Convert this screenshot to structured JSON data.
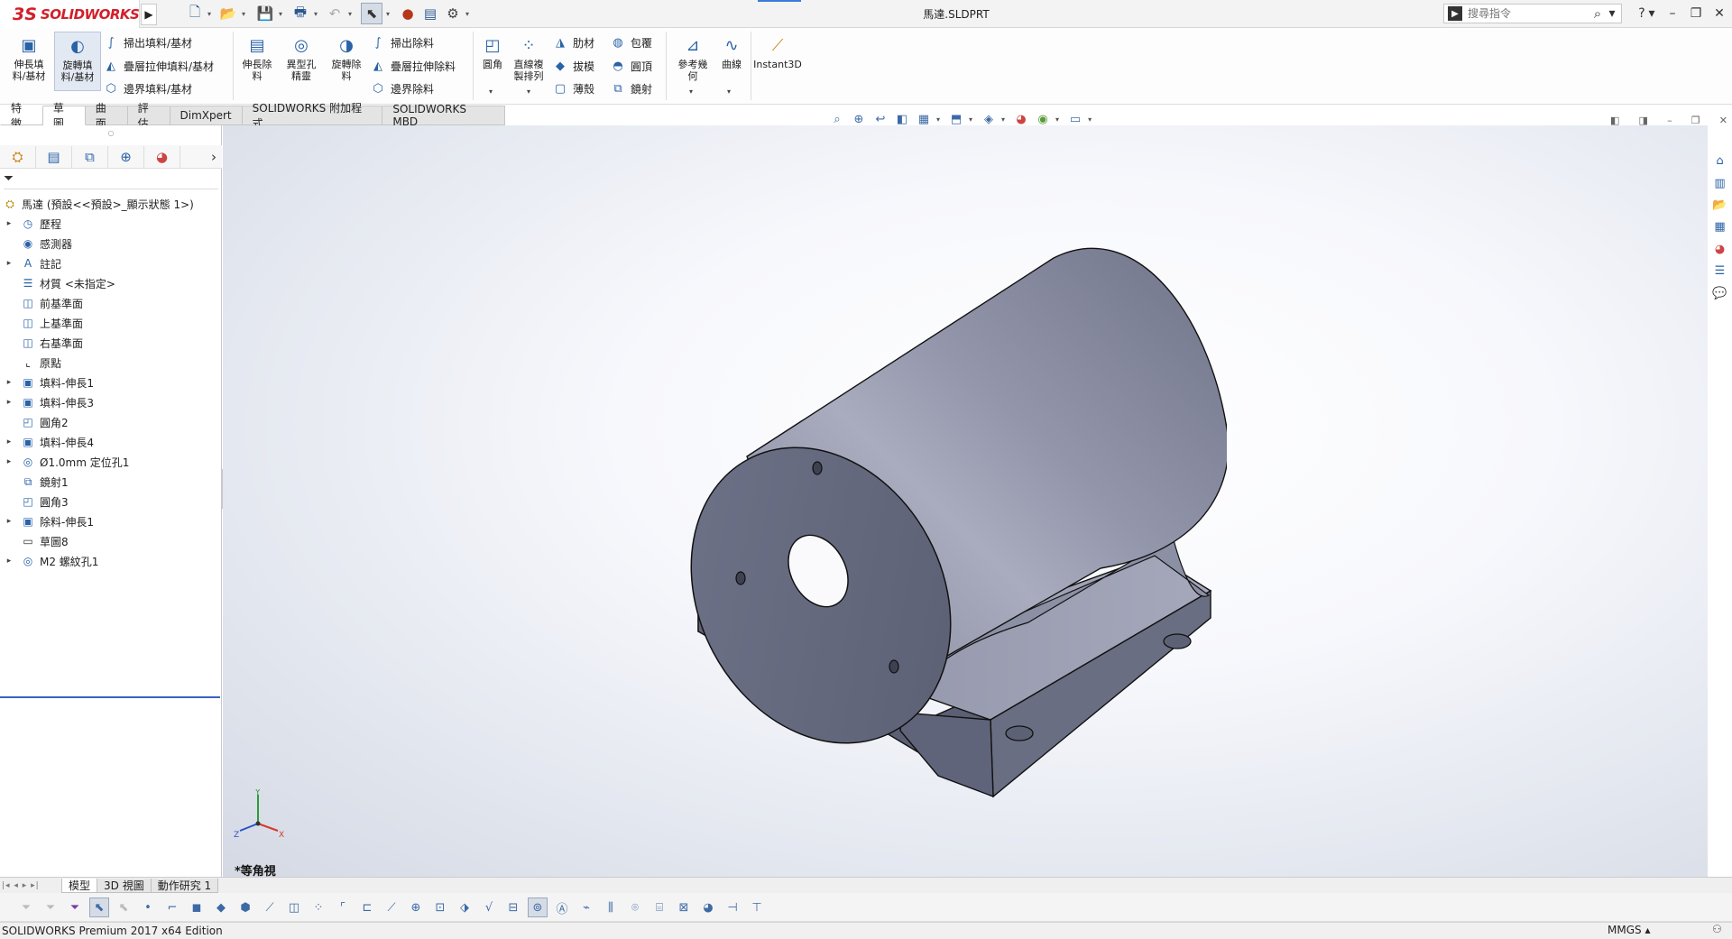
{
  "app": {
    "logo_ds": "3S",
    "logo_text": "SOLIDWORKS",
    "doc_title": "馬達.SLDPRT",
    "search_placeholder": "搜尋指令"
  },
  "colors": {
    "brand": "#d21f2b",
    "accent": "#3a7ad8",
    "model_face": "#8d91a7",
    "model_dark": "#5d6075",
    "selection": "#3a63c2"
  },
  "quick_access": [
    {
      "name": "new-document-icon",
      "glyph": "🗋"
    },
    {
      "name": "open-icon",
      "glyph": "📂"
    },
    {
      "name": "save-icon",
      "glyph": "💾"
    },
    {
      "name": "print-icon",
      "glyph": "🖶"
    },
    {
      "name": "undo-icon",
      "glyph": "↶"
    },
    {
      "name": "select-icon",
      "glyph": "⬉"
    },
    {
      "name": "rebuild-icon",
      "glyph": "🚦"
    },
    {
      "name": "file-properties-icon",
      "glyph": "▤"
    },
    {
      "name": "options-icon",
      "glyph": "⚙"
    }
  ],
  "ribbon": {
    "extrude_boss": "伸長填\n料/基材",
    "revolve_boss": "旋轉填\n料/基材",
    "sweep_boss": "掃出填料/基材",
    "loft_boss": "疊層拉伸填料/基材",
    "boundary_boss": "邊界填料/基材",
    "extrude_cut": "伸長除\n料",
    "hole_wizard": "異型孔\n精靈",
    "revolve_cut": "旋轉除\n料",
    "sweep_cut": "掃出除料",
    "loft_cut": "疊層拉伸除料",
    "boundary_cut": "邊界除料",
    "fillet": "圓角",
    "linear_pattern": "直線複\n製排列",
    "rib": "肋材",
    "draft": "拔模",
    "shell": "薄殼",
    "wrap": "包覆",
    "dome": "圓頂",
    "mirror": "鏡射",
    "reference_geometry": "參考幾\n何",
    "curves": "曲線",
    "instant3d": "Instant3D"
  },
  "command_tabs": [
    "特徵",
    "草圖",
    "曲面",
    "評估",
    "DimXpert",
    "SOLIDWORKS 附加程式",
    "SOLIDWORKS MBD"
  ],
  "feature_tree": [
    {
      "label": "馬達 (預設<<預設>_顯示狀態 1>)",
      "expand": "",
      "glyph": "⛭",
      "root": true
    },
    {
      "label": "歷程",
      "expand": "▸",
      "glyph": "◷"
    },
    {
      "label": "感測器",
      "expand": "",
      "glyph": "◉"
    },
    {
      "label": "註記",
      "expand": "▸",
      "glyph": "A"
    },
    {
      "label": "材質 <未指定>",
      "expand": "",
      "glyph": "☰"
    },
    {
      "label": "前基準面",
      "expand": "",
      "glyph": "◫"
    },
    {
      "label": "上基準面",
      "expand": "",
      "glyph": "◫"
    },
    {
      "label": "右基準面",
      "expand": "",
      "glyph": "◫"
    },
    {
      "label": "原點",
      "expand": "",
      "glyph": "⌞"
    },
    {
      "label": "填料-伸長1",
      "expand": "▸",
      "glyph": "▣"
    },
    {
      "label": "填料-伸長3",
      "expand": "▸",
      "glyph": "▣"
    },
    {
      "label": "圓角2",
      "expand": "",
      "glyph": "◰"
    },
    {
      "label": "填料-伸長4",
      "expand": "▸",
      "glyph": "▣"
    },
    {
      "label": "Ø1.0mm 定位孔1",
      "expand": "▸",
      "glyph": "◎"
    },
    {
      "label": "鏡射1",
      "expand": "",
      "glyph": "⧉"
    },
    {
      "label": "圓角3",
      "expand": "",
      "glyph": "◰"
    },
    {
      "label": "除料-伸長1",
      "expand": "▸",
      "glyph": "▣"
    },
    {
      "label": "草圖8",
      "expand": "",
      "glyph": "▭"
    },
    {
      "label": "M2 螺紋孔1",
      "expand": "▸",
      "glyph": "◎"
    }
  ],
  "view_label": "*等角視",
  "bottom_tabs": [
    "模型",
    "3D 視圖",
    "動作研究 1"
  ],
  "status": {
    "edition": "SOLIDWORKS Premium 2017 x64 Edition",
    "units": "MMGS ▴"
  }
}
